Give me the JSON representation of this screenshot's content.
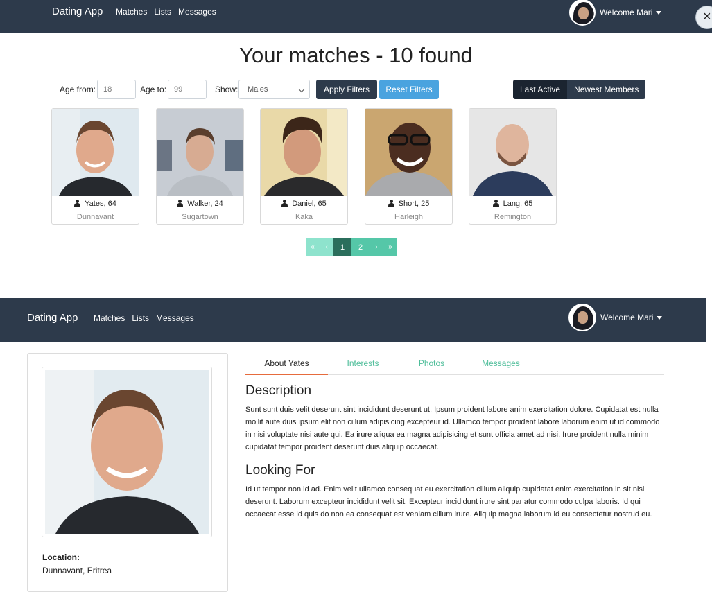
{
  "top_nav": {
    "brand": "Dating App",
    "links": [
      "Matches",
      "Lists",
      "Messages"
    ],
    "user_label": "Welcome Mari"
  },
  "matches": {
    "title": "Your matches - 10 found",
    "filters": {
      "age_from_label": "Age from:",
      "age_from_value": "18",
      "age_to_label": "Age to:",
      "age_to_value": "99",
      "show_label": "Show:",
      "show_value": "Males",
      "apply_label": "Apply Filters",
      "reset_label": "Reset Filters"
    },
    "sort": {
      "active_label": "Last Active",
      "newest_label": "Newest Members"
    },
    "cards": [
      {
        "name": "Yates, 64",
        "city": "Dunnavant"
      },
      {
        "name": "Walker, 24",
        "city": "Sugartown"
      },
      {
        "name": "Daniel, 65",
        "city": "Kaka"
      },
      {
        "name": "Short, 25",
        "city": "Harleigh"
      },
      {
        "name": "Lang, 65",
        "city": "Remington"
      }
    ],
    "pagination": {
      "first": "«",
      "prev": "‹",
      "pages": [
        "1",
        "2"
      ],
      "current_page": "1",
      "next": "›",
      "last": "»"
    }
  },
  "bottom_nav": {
    "brand": "Dating App",
    "links": [
      "Matches",
      "Lists",
      "Messages"
    ],
    "user_label": "Welcome Mari"
  },
  "detail": {
    "location_label": "Location:",
    "location_value": "Dunnavant, Eritrea",
    "tabs": [
      "About Yates",
      "Interests",
      "Photos",
      "Messages"
    ],
    "description_title": "Description",
    "description_text": "Sunt sunt duis velit deserunt sint incididunt deserunt ut. Ipsum proident labore anim exercitation dolore. Cupidatat est nulla mollit aute duis ipsum elit non cillum adipisicing excepteur id. Ullamco tempor proident labore laborum enim ut id commodo in nisi voluptate nisi aute qui. Ea irure aliqua ea magna adipisicing et sunt officia amet ad nisi. Irure proident nulla minim cupidatat tempor proident deserunt duis aliquip occaecat.",
    "looking_title": "Looking For",
    "looking_text": "Id ut tempor non id ad. Enim velit ullamco consequat eu exercitation cillum aliquip cupidatat enim exercitation in sit nisi deserunt. Laborum excepteur incididunt velit sit. Excepteur incididunt irure sint pariatur commodo culpa laboris. Id qui occaecat esse id quis do non ea consequat est veniam cillum irure. Aliquip magna laborum id eu consectetur nostrud eu."
  },
  "icons": {
    "close": "close-icon",
    "person": "person-icon",
    "caret": "caret-down-icon"
  },
  "colors": {
    "navbar": "#2d3a4b",
    "apply_button": "#2d3a4b",
    "reset_button": "#4aa3df",
    "pagination": "#55c7a8",
    "tab_active_underline": "#e66b3d",
    "tab_inactive_text": "#4dbd99"
  }
}
